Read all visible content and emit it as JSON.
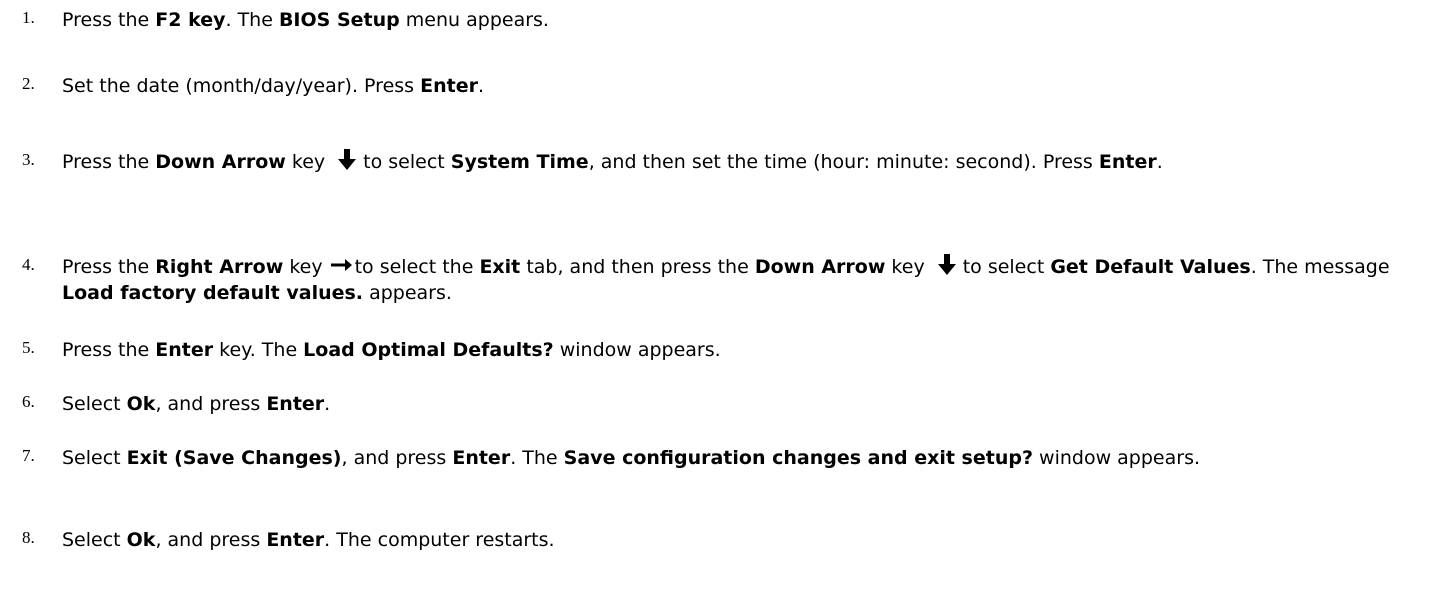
{
  "steps": [
    {
      "number": "1.",
      "parts": [
        "Press the ",
        "F2 key",
        ". The ",
        "BIOS Setup",
        " menu appears."
      ]
    },
    {
      "number": "2.",
      "parts": [
        "Set the date (month/day/year). Press ",
        "Enter",
        "."
      ]
    },
    {
      "number": "3.",
      "parts": [
        "Press the ",
        "Down Arrow",
        " key",
        "to select ",
        "System Time",
        ", and then set the time (hour: minute: second). Press ",
        "Enter",
        "."
      ]
    },
    {
      "number": "4.",
      "parts": [
        "Press the ",
        "Right Arrow",
        " key",
        "to select the ",
        "Exit",
        " tab, and then press the ",
        "Down Arrow",
        " key",
        "to select ",
        "Get Default Values",
        ". The message ",
        "Load factory default values.",
        " appears."
      ]
    },
    {
      "number": "5.",
      "parts": [
        "Press the ",
        "Enter",
        " key. The ",
        "Load Optimal Defaults?",
        " window appears."
      ]
    },
    {
      "number": "6.",
      "parts": [
        "Select ",
        "Ok",
        ", and press ",
        "Enter",
        "."
      ]
    },
    {
      "number": "7.",
      "parts": [
        "Select ",
        "Exit (Save Changes)",
        ", and press ",
        "Enter",
        ". The ",
        "Save configuration changes and exit setup?",
        " window appears."
      ]
    },
    {
      "number": "8.",
      "parts": [
        "Select ",
        "Ok",
        ", and press ",
        "Enter",
        ". The computer restarts."
      ]
    }
  ],
  "icons": {
    "down_arrow": "down-arrow-icon",
    "right_arrow": "right-arrow-icon"
  }
}
